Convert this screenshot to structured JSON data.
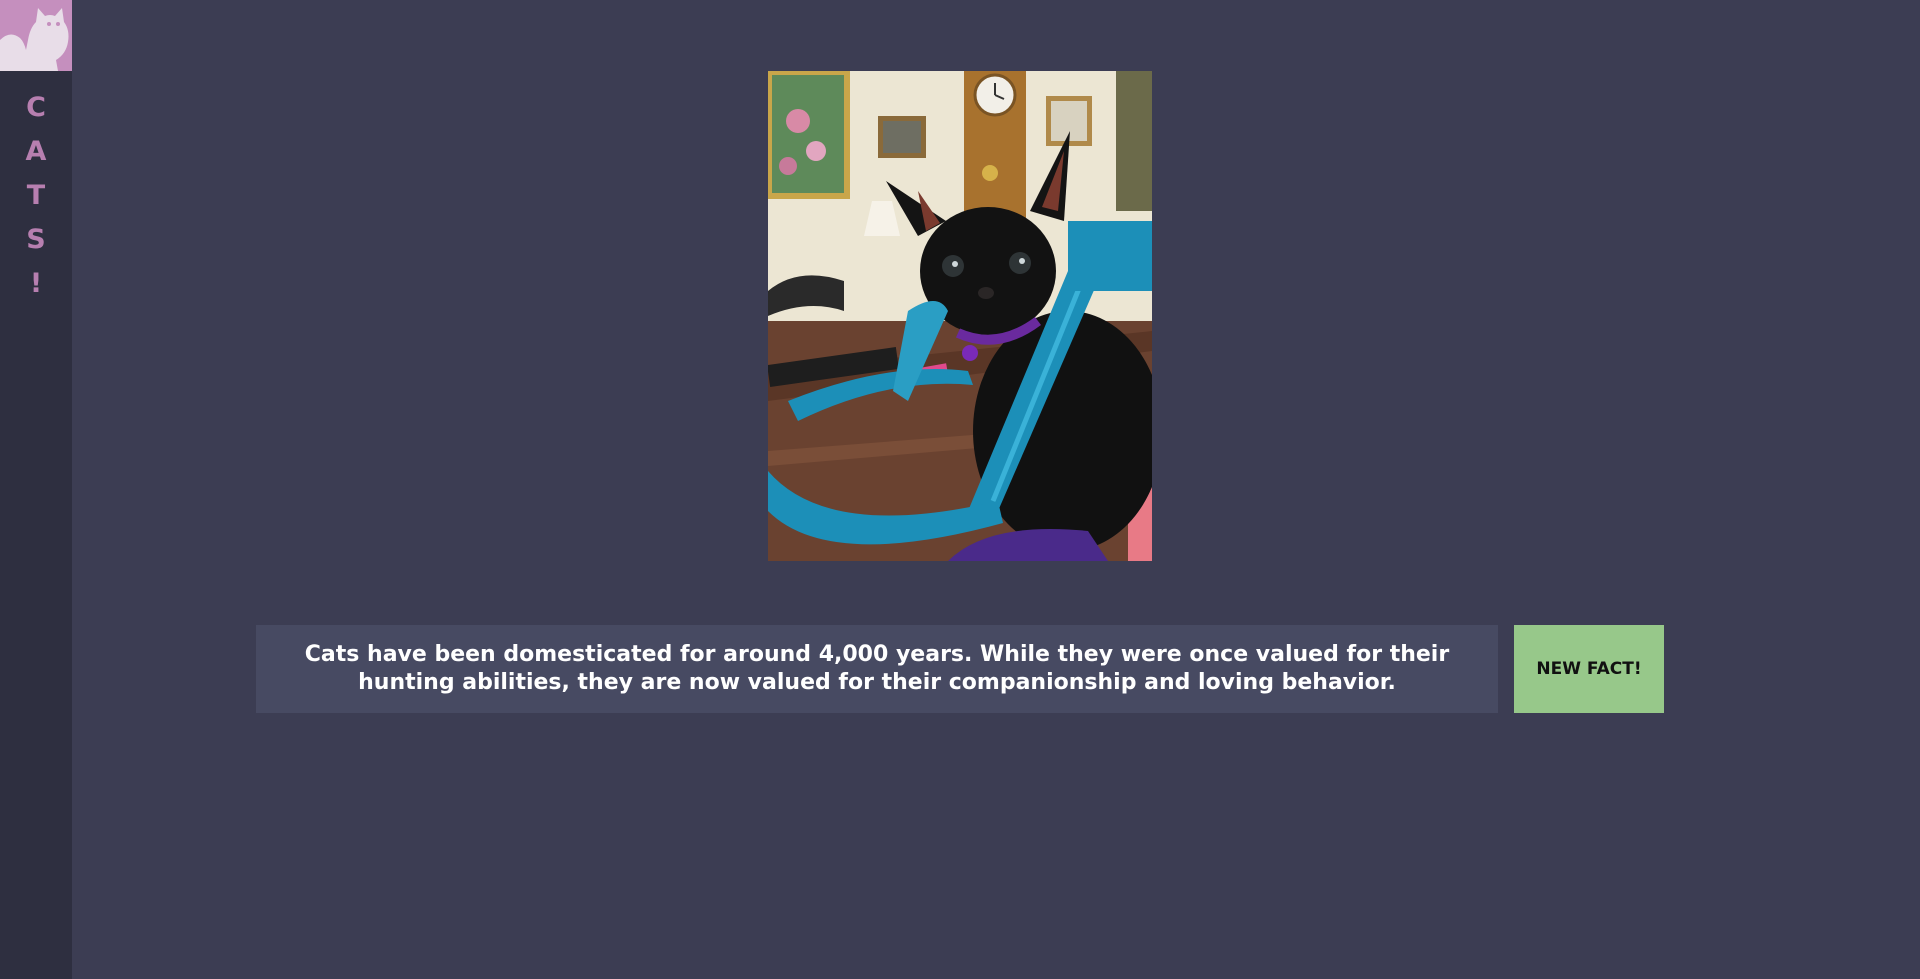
{
  "sidebar": {
    "logo_icon": "cat-silhouette-icon",
    "brand_letters": [
      "C",
      "A",
      "T",
      "S",
      "!"
    ]
  },
  "main": {
    "photo_icon": "black-kitten-photo",
    "fact_text": "Cats have been domesticated for around 4,000 years. While they were once valued for their hunting abilities, they are now valued for their companionship and loving behavior.",
    "new_fact_label": "NEW FACT!"
  },
  "colors": {
    "background": "#3c3d53",
    "sidebar": "#2e2f40",
    "accent_pink": "#c58fbe",
    "fact_box": "#474a62",
    "button_green": "#97c88a"
  }
}
